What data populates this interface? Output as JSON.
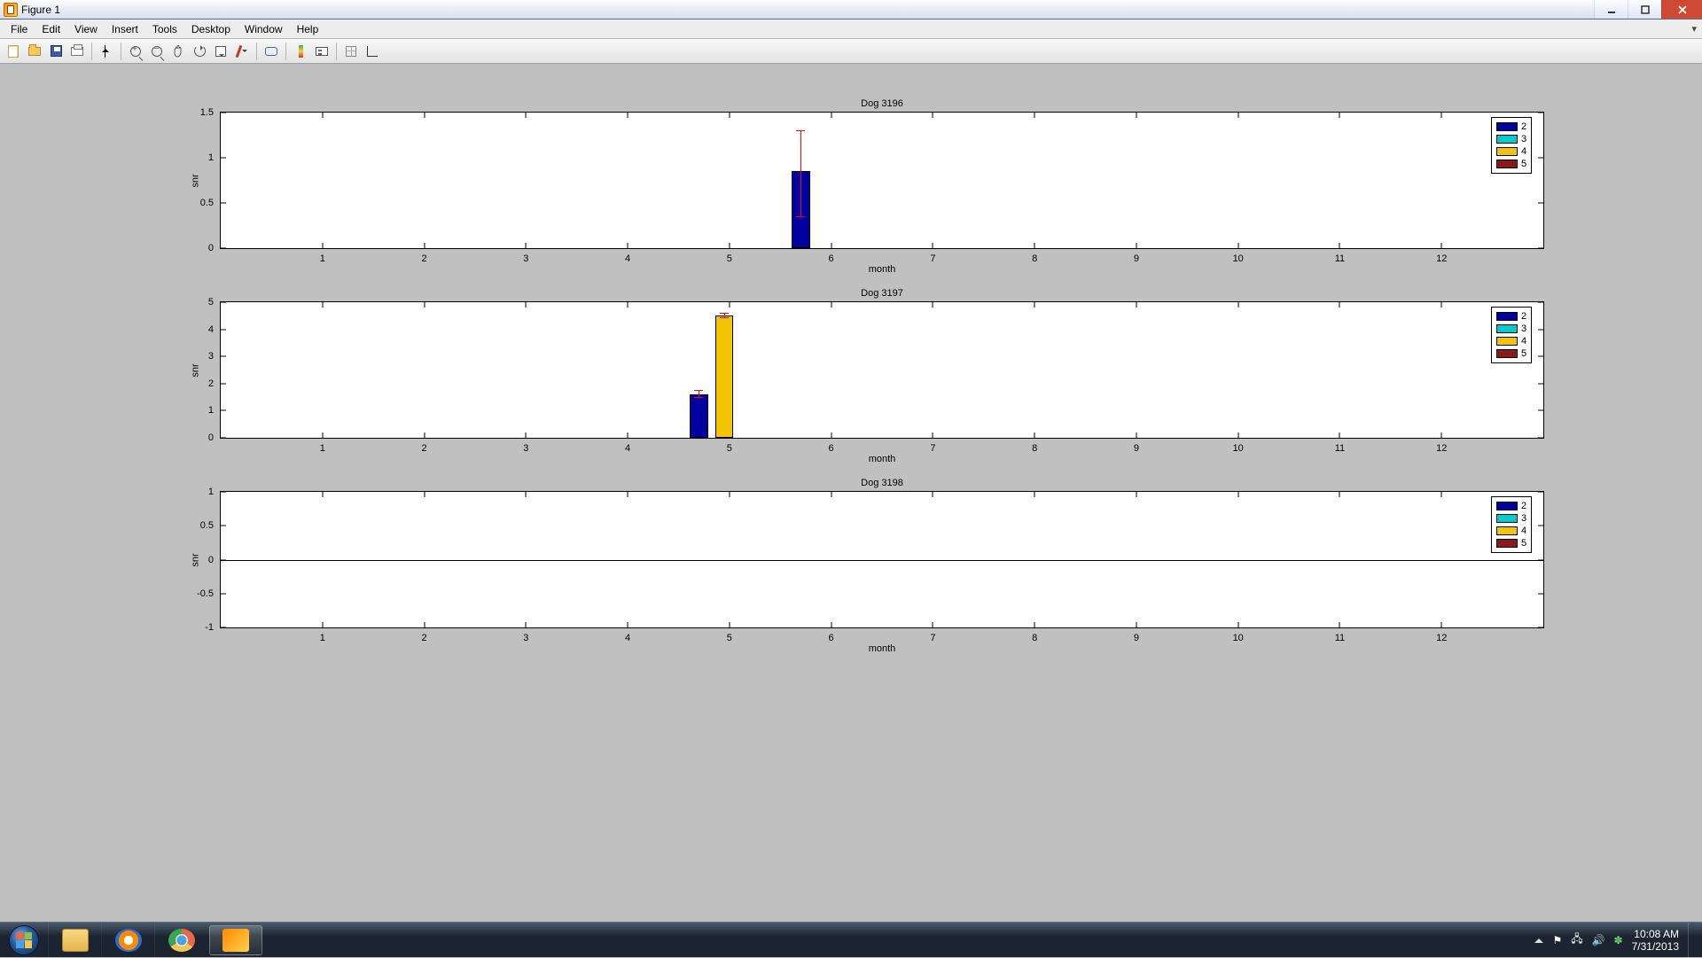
{
  "window": {
    "title": "Figure 1"
  },
  "menu": {
    "file": "File",
    "edit": "Edit",
    "view": "View",
    "insert": "Insert",
    "tools": "Tools",
    "desktop": "Desktop",
    "window": "Window",
    "help": "Help"
  },
  "toolbar": {
    "new": "New Figure",
    "open": "Open",
    "save": "Save",
    "print": "Print",
    "pointer": "Edit Plot",
    "zoomin": "Zoom In",
    "zoomout": "Zoom Out",
    "pan": "Pan",
    "rotate": "Rotate 3D",
    "datatip": "Data Cursor",
    "brush": "Brush",
    "link": "Link Plot",
    "colorbar": "Insert Colorbar",
    "legend": "Insert Legend",
    "hide": "Hide Plot Tools",
    "show": "Show Plot Tools",
    "dock_caret": "▾"
  },
  "legend": {
    "entries": [
      "2",
      "3",
      "4",
      "5"
    ],
    "colors": [
      "#0000a0",
      "#00cccc",
      "#f2c500",
      "#8b1a1a"
    ]
  },
  "subplot1": {
    "title": "Dog 3196",
    "ylabel": "snr",
    "xlabel": "month"
  },
  "subplot2": {
    "title": "Dog 3197",
    "ylabel": "snr",
    "xlabel": "month"
  },
  "subplot3": {
    "title": "Dog 3198",
    "ylabel": "snr",
    "xlabel": "month"
  },
  "yt1": {
    "a": "0",
    "b": "0.5",
    "c": "1",
    "d": "1.5"
  },
  "yt2": {
    "a": "0",
    "b": "1",
    "c": "2",
    "d": "3",
    "e": "4",
    "f": "5"
  },
  "yt3": {
    "a": "-1",
    "b": "-0.5",
    "c": "0",
    "d": "0.5",
    "e": "1"
  },
  "xt": {
    "1": "1",
    "2": "2",
    "3": "3",
    "4": "4",
    "5": "5",
    "6": "6",
    "7": "7",
    "8": "8",
    "9": "9",
    "10": "10",
    "11": "11",
    "12": "12"
  },
  "taskbar": {
    "time": "10:08 AM",
    "date": "7/31/2013"
  },
  "chart_data": [
    {
      "title": "Dog 3196",
      "type": "bar",
      "xlabel": "month",
      "ylabel": "snr",
      "xlim": [
        0,
        13
      ],
      "ylim": [
        0,
        1.5
      ],
      "xticks": [
        1,
        2,
        3,
        4,
        5,
        6,
        7,
        8,
        9,
        10,
        11,
        12
      ],
      "yticks": [
        0,
        0.5,
        1,
        1.5
      ],
      "legend": [
        "2",
        "3",
        "4",
        "5"
      ],
      "series": [
        {
          "name": "2",
          "color": "#0000a0",
          "x": [
            5.7
          ],
          "y": [
            0.85
          ],
          "err_low": [
            0.35
          ],
          "err_high": [
            1.3
          ]
        },
        {
          "name": "3",
          "color": "#00cccc",
          "x": [],
          "y": []
        },
        {
          "name": "4",
          "color": "#f2c500",
          "x": [],
          "y": []
        },
        {
          "name": "5",
          "color": "#8b1a1a",
          "x": [],
          "y": []
        }
      ]
    },
    {
      "title": "Dog 3197",
      "type": "bar",
      "xlabel": "month",
      "ylabel": "snr",
      "xlim": [
        0,
        13
      ],
      "ylim": [
        0,
        5
      ],
      "xticks": [
        1,
        2,
        3,
        4,
        5,
        6,
        7,
        8,
        9,
        10,
        11,
        12
      ],
      "yticks": [
        0,
        1,
        2,
        3,
        4,
        5
      ],
      "legend": [
        "2",
        "3",
        "4",
        "5"
      ],
      "series": [
        {
          "name": "2",
          "color": "#0000a0",
          "x": [
            4.7
          ],
          "y": [
            1.6
          ],
          "err_low": [
            1.5
          ],
          "err_high": [
            1.75
          ]
        },
        {
          "name": "3",
          "color": "#00cccc",
          "x": [],
          "y": []
        },
        {
          "name": "4",
          "color": "#f2c500",
          "x": [
            4.95
          ],
          "y": [
            4.5
          ],
          "err_low": [
            4.45
          ],
          "err_high": [
            4.6
          ]
        },
        {
          "name": "5",
          "color": "#8b1a1a",
          "x": [],
          "y": []
        }
      ]
    },
    {
      "title": "Dog 3198",
      "type": "bar",
      "xlabel": "month",
      "ylabel": "snr",
      "xlim": [
        0,
        13
      ],
      "ylim": [
        -1,
        1
      ],
      "xticks": [
        1,
        2,
        3,
        4,
        5,
        6,
        7,
        8,
        9,
        10,
        11,
        12
      ],
      "yticks": [
        -1,
        -0.5,
        0,
        0.5,
        1
      ],
      "legend": [
        "2",
        "3",
        "4",
        "5"
      ],
      "series": [
        {
          "name": "2",
          "color": "#0000a0",
          "x": [],
          "y": []
        },
        {
          "name": "3",
          "color": "#00cccc",
          "x": [],
          "y": []
        },
        {
          "name": "4",
          "color": "#f2c500",
          "x": [],
          "y": []
        },
        {
          "name": "5",
          "color": "#8b1a1a",
          "x": [],
          "y": []
        }
      ]
    }
  ]
}
